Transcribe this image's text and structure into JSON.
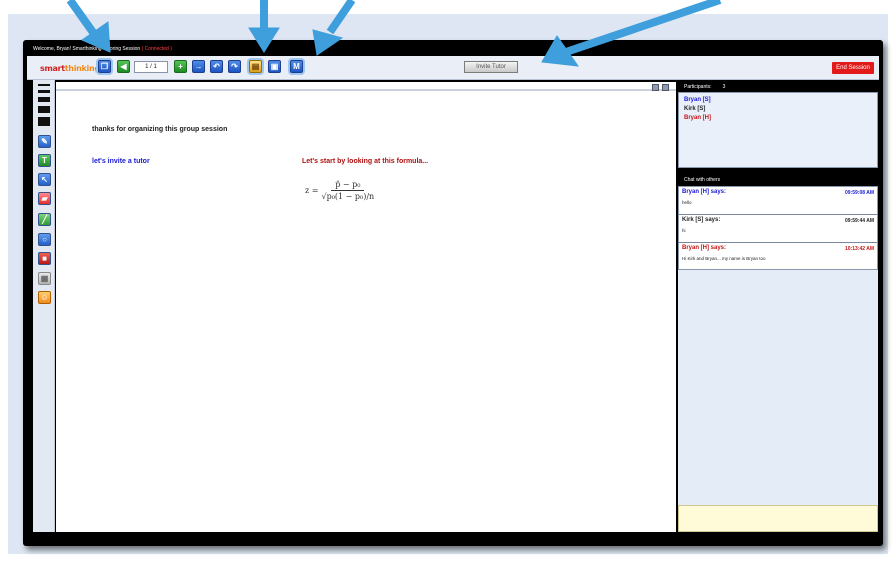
{
  "titlebar": {
    "welcome": "Welcome, Bryan!",
    "session": "Smarthinking Tutoring Session",
    "status": "( Connected )"
  },
  "toolbar": {
    "logo_a": "smart",
    "logo_b": "thinking",
    "page_indicator": "1 / 1",
    "invite_tutor_label": "Invite Tutor",
    "end_session_label": "End Session"
  },
  "canvas": {
    "line1": "thanks for organizing this group session",
    "line2": "let's invite a tutor",
    "line3": "Let's start by looking at this formula...",
    "formula_lhs": "z =",
    "formula_num": "p̂ − p₀",
    "formula_den": "√p₀(1 − p₀)/n"
  },
  "participants": {
    "header": "Participants:",
    "count": "3",
    "names": [
      "Bryan [S]",
      "Kirk [S]",
      "Bryan [H]"
    ],
    "colors": [
      "#1a1ad6",
      "#222222",
      "#c41414"
    ]
  },
  "chat": {
    "header": "Chat with others",
    "messages": [
      {
        "who": "Bryan [H] says:",
        "time": "09:59:08 AM",
        "text": "hello",
        "color": "#1a1ad6"
      },
      {
        "who": "Kirk [S] says:",
        "time": "09:59:44 AM",
        "text": "hi",
        "color": "#222222"
      },
      {
        "who": "Bryan [H] says:",
        "time": "10:13:42 AM",
        "text": "Hi Kirk and Bryan... my name is Bryan too",
        "color": "#c41414"
      }
    ]
  },
  "colors": {
    "accent_arrow": "#3f9fdc",
    "text_blue": "#1a1ad6",
    "text_red": "#b01010"
  }
}
